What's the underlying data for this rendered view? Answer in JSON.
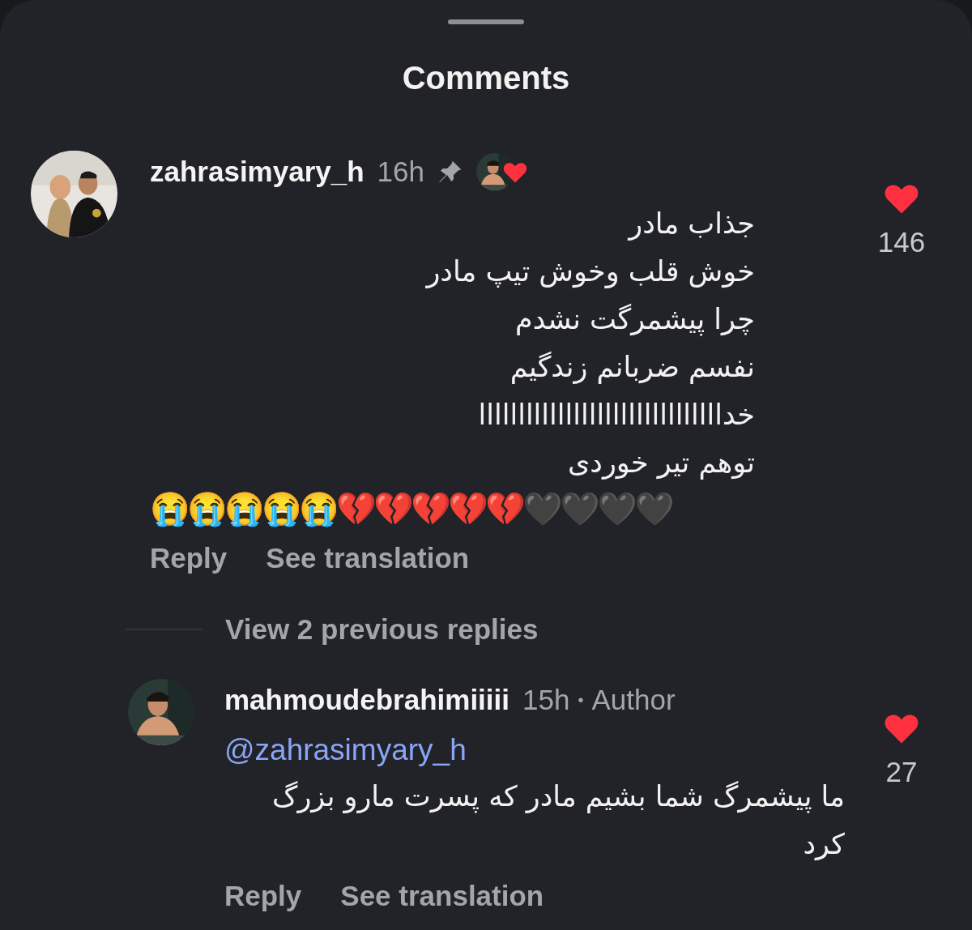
{
  "title": "Comments",
  "comments": [
    {
      "username": "zahrasimyary_h",
      "time": "16h",
      "pinned": true,
      "liked_by_author": true,
      "lines": [
        "جذاب مادر",
        "خوش قلب وخوش تیپ مادر",
        "چرا پیشمرگت نشدم",
        "نفسم ضربانم زندگیم",
        "خدااااااااااااااااااااااااااااااا",
        "توهم تیر خوردی"
      ],
      "emoji": "😭😭😭😭😭💔💔💔💔💔🖤🖤🖤🖤",
      "liked": true,
      "likes": "146",
      "reply_label": "Reply",
      "translate_label": "See translation"
    }
  ],
  "view_replies": "View 2 previous replies",
  "replies": [
    {
      "username": "mahmoudebrahimiiiii",
      "time": "15h",
      "separator": "•",
      "badge": "Author",
      "mention": "@zahrasimyary_h",
      "text": "ما پیشمرگ شما بشیم مادر که پسرت مارو بزرگ کرد",
      "liked": true,
      "likes": "27",
      "reply_label": "Reply",
      "translate_label": "See translation"
    }
  ]
}
